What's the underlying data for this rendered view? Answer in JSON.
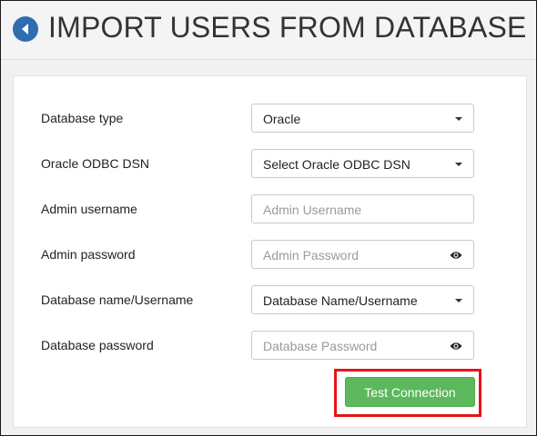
{
  "header": {
    "title": "IMPORT USERS FROM DATABASE",
    "back_icon": "back-arrow-icon",
    "accent_color": "#2f6db0"
  },
  "form": {
    "database_type": {
      "label": "Database type",
      "value": "Oracle"
    },
    "odbc_dsn": {
      "label": "Oracle ODBC DSN",
      "value": "Select Oracle ODBC DSN"
    },
    "admin_username": {
      "label": "Admin username",
      "placeholder": "Admin Username"
    },
    "admin_password": {
      "label": "Admin password",
      "placeholder": "Admin Password",
      "icon": "eye-icon"
    },
    "db_name": {
      "label": "Database name/Username",
      "value": "Database Name/Username"
    },
    "db_password": {
      "label": "Database password",
      "placeholder": "Database Password",
      "icon": "eye-icon"
    }
  },
  "actions": {
    "test_connection_label": "Test Connection",
    "button_color": "#5cb85c",
    "highlight_color": "#e3151a"
  }
}
